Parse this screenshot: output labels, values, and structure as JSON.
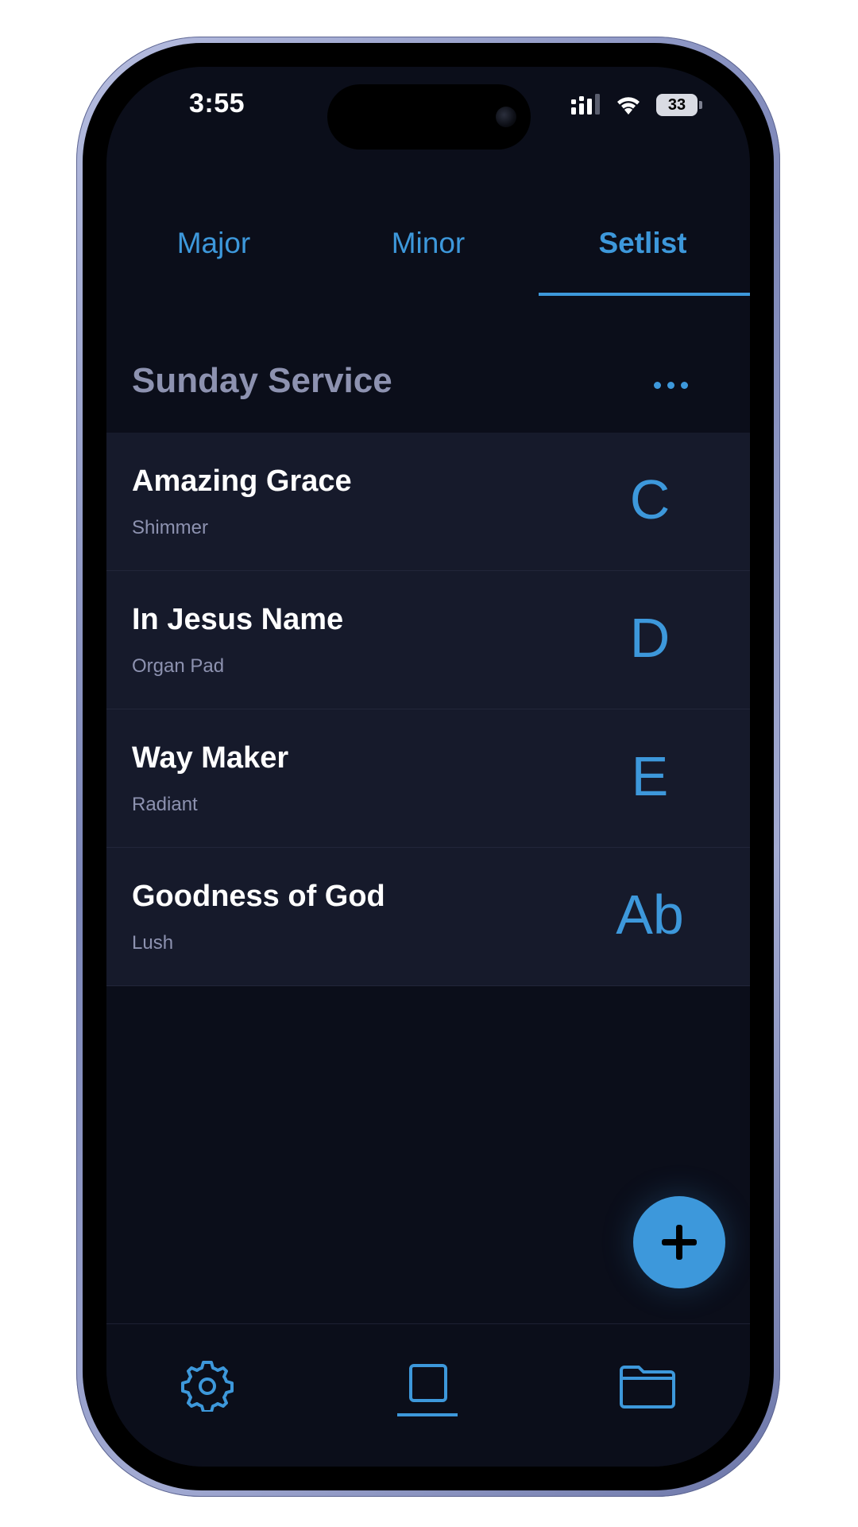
{
  "status_bar": {
    "time": "3:55",
    "battery": "33"
  },
  "tabs": [
    {
      "label": "Major",
      "active": false
    },
    {
      "label": "Minor",
      "active": false
    },
    {
      "label": "Setlist",
      "active": true
    }
  ],
  "setlist": {
    "title": "Sunday Service",
    "more_icon": "ellipsis-icon",
    "songs": [
      {
        "title": "Amazing Grace",
        "sound": "Shimmer",
        "key": "C"
      },
      {
        "title": "In Jesus Name",
        "sound": "Organ Pad",
        "key": "D"
      },
      {
        "title": "Way Maker",
        "sound": "Radiant",
        "key": "E"
      },
      {
        "title": "Goodness of God",
        "sound": "Lush",
        "key": "Ab"
      }
    ]
  },
  "fab": {
    "icon": "plus-icon"
  },
  "bottom_nav": {
    "items": [
      {
        "icon": "gear-icon",
        "active": false
      },
      {
        "icon": "square-icon",
        "active": true
      },
      {
        "icon": "folder-icon",
        "active": false
      }
    ]
  },
  "colors": {
    "background": "#0b0e1a",
    "row_background": "#161a2b",
    "accent": "#3d98db",
    "secondary_text": "#8d92b0"
  }
}
